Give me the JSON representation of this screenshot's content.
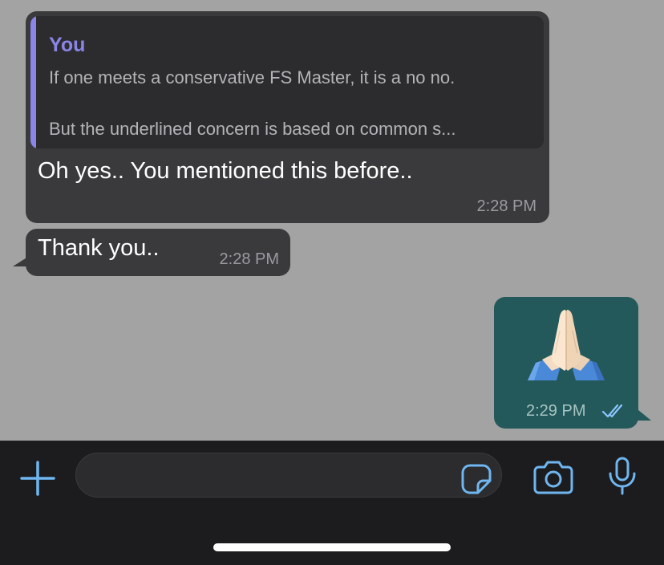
{
  "messages": {
    "m1": {
      "quote_author": "You",
      "quote_line1": "If one meets a conservative FS Master, it is a no no.",
      "quote_line2": "But the underlined concern is based on common s...",
      "text": "Oh yes.. You mentioned this before..",
      "time": "2:28 PM"
    },
    "m2": {
      "text": "Thank you..",
      "time": "2:28 PM"
    },
    "m3": {
      "emoji": "folded-hands-emoji",
      "time": "2:29 PM",
      "status": "read"
    }
  },
  "input": {
    "placeholder": ""
  },
  "colors": {
    "chat_background": "#a3a3a3",
    "incoming_bubble": "#3a3a3c",
    "outgoing_bubble": "#23595a",
    "quote_accent": "#8a85e8",
    "icon_blue": "#6fb6f0",
    "input_bar": "#1c1c1e"
  },
  "icons": [
    "plus-icon",
    "sticker-icon",
    "camera-icon",
    "microphone-icon",
    "double-check-icon"
  ]
}
